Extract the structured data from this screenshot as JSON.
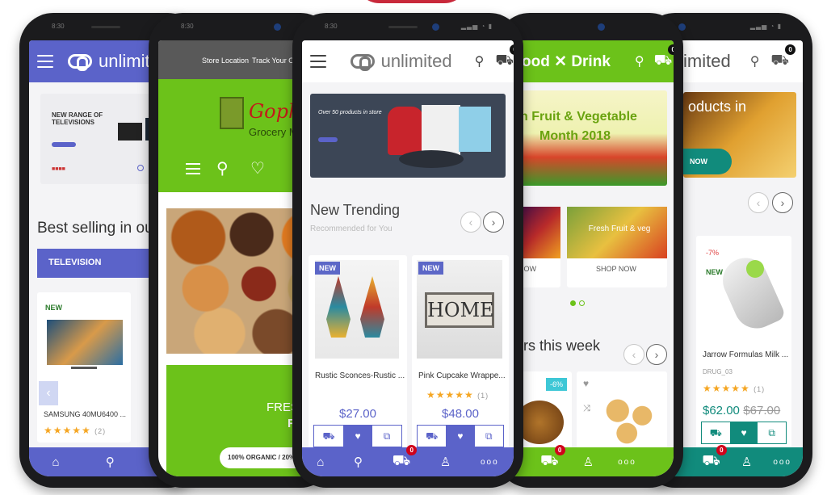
{
  "phone1": {
    "app_name": "unlimited",
    "banner_title": "NEW RANGE OF TELEVISIONS",
    "section_title": "Best selling in our",
    "category_tab": "TELEVISION",
    "product": {
      "tag": "NEW",
      "name": "SAMSUNG 40MU6400 ...",
      "reviews": "(2)"
    },
    "cart_count": "0"
  },
  "phone2": {
    "nav_store": "Store Location",
    "nav_track": "Track Your Ord",
    "brand_name": "Gophe",
    "brand_sub": "Grocery M",
    "promo_line1": "FRES",
    "promo_line2": "F",
    "promo_button": "100% ORGANIC / 20% OF"
  },
  "phone3": {
    "status_time": "8:30",
    "app_name": "unlimited",
    "cart_count": "0",
    "nav_cart_count": "0",
    "banner_text": "Over 50 products in store",
    "section_title": "New Trending",
    "section_subtitle": "Recommended for You",
    "products": [
      {
        "tag": "NEW",
        "name": "Rustic Sconces-Rustic ...",
        "price": "$27.00",
        "reviews": ""
      },
      {
        "tag": "NEW",
        "name": "Pink Cupcake Wrappe...",
        "price": "$48.00",
        "reviews": "(1)"
      }
    ],
    "nav_more": "ooo"
  },
  "phone4": {
    "brand_name_a": "ood",
    "brand_name_b": "Drink",
    "cart_count": "0",
    "nav_cart_count": "0",
    "banner_line1": "h Fruit & Vegetable",
    "banner_line2": "Month 2018",
    "promo_left_btn": "NOW",
    "promo_right_title": "Fresh Fruit & veg",
    "promo_right_btn": "SHOP NOW",
    "section_title": "ers this week",
    "discount": "-6%",
    "nav_more": "ooo"
  },
  "phone5": {
    "app_name": "imited",
    "cart_count": "0",
    "nav_cart_count": "0",
    "banner_text": "oducts in",
    "banner_btn": "NOW",
    "product": {
      "discount": "-7%",
      "tag": "NEW",
      "name": "Jarrow Formulas Milk ...",
      "sku": "DRUG_03",
      "reviews": "(1)",
      "price": "$62.00",
      "old_price": "$67.00"
    },
    "nav_more": "ooo"
  },
  "colors": {
    "accent_blue": "#5b63c9",
    "accent_green": "#6cc21a",
    "accent_teal": "#118b7c",
    "badge_red": "#d0021b"
  }
}
